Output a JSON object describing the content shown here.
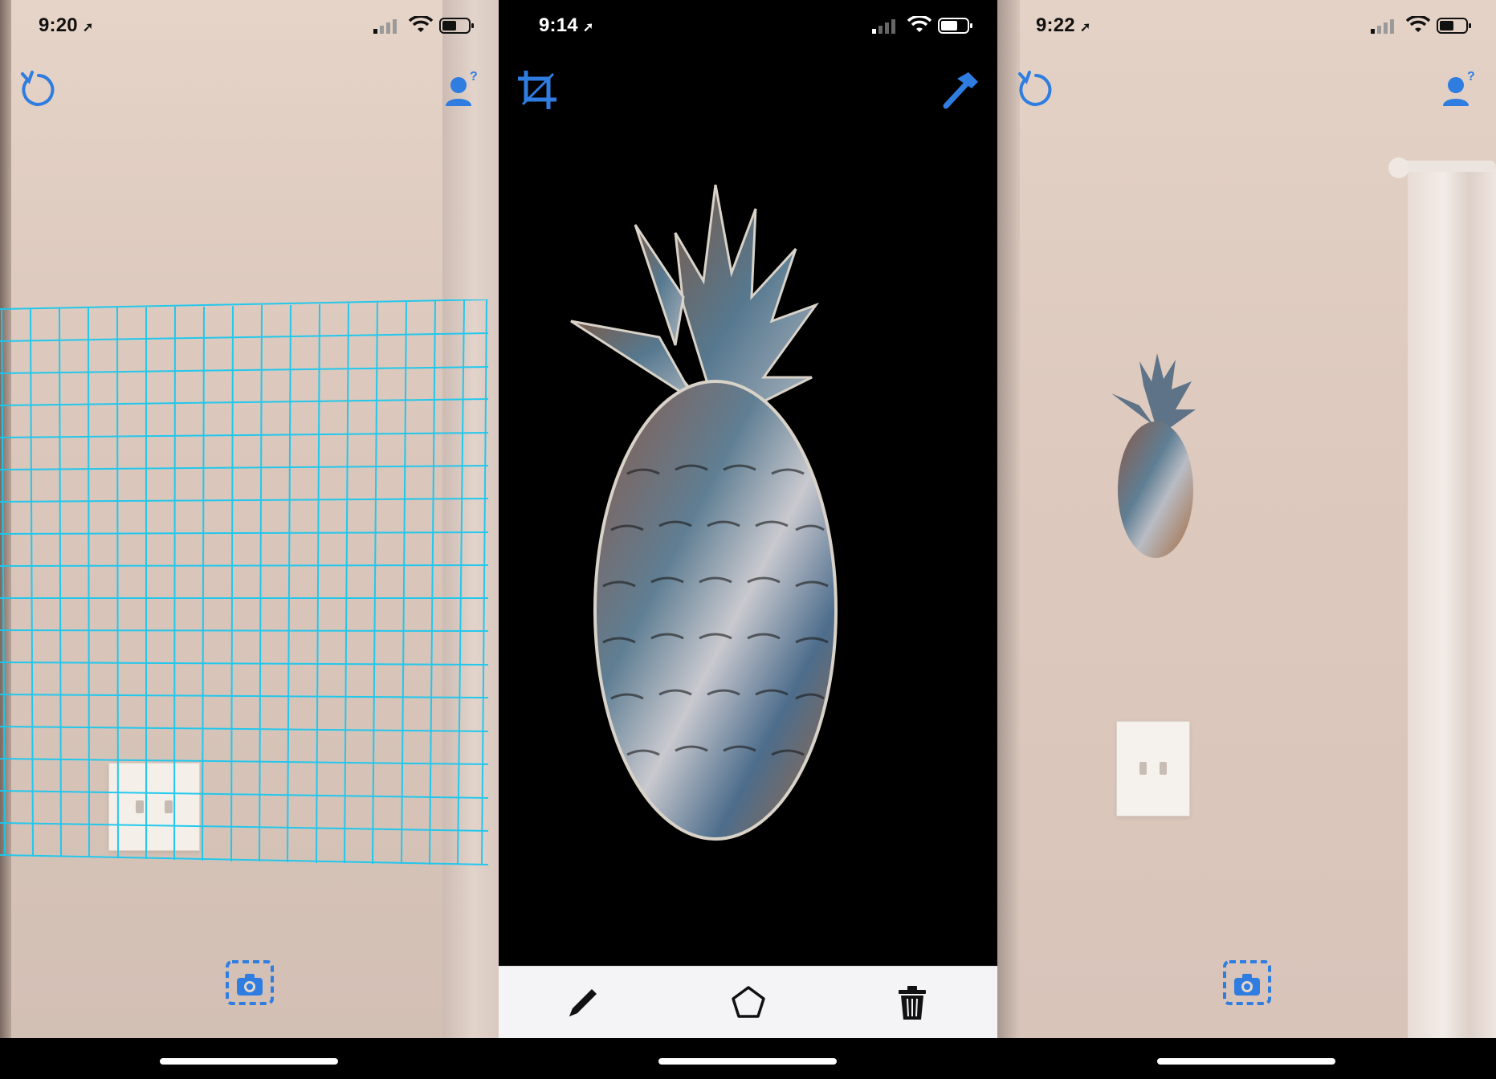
{
  "panels": [
    {
      "status": {
        "time": "9:20"
      },
      "top_left_icon": "refresh-icon",
      "top_right_icon": "user-help-icon",
      "bottom_icon": "camera-capture-icon",
      "overlay": "ar-plane-grid"
    },
    {
      "status": {
        "time": "9:14"
      },
      "top_left_icon": "crop-icon",
      "top_right_icon": "hammer-icon",
      "toolbar": {
        "items": [
          "pencil-icon",
          "pentagon-icon",
          "trash-icon"
        ]
      }
    },
    {
      "status": {
        "time": "9:22"
      },
      "top_left_icon": "refresh-icon",
      "top_right_icon": "user-help-icon",
      "bottom_icon": "camera-capture-icon"
    }
  ],
  "colors": {
    "accent": "#2f7de1",
    "grid": "#19c8f0",
    "toolbar_bg": "#f4f4f6",
    "dark_bg": "#000000"
  }
}
